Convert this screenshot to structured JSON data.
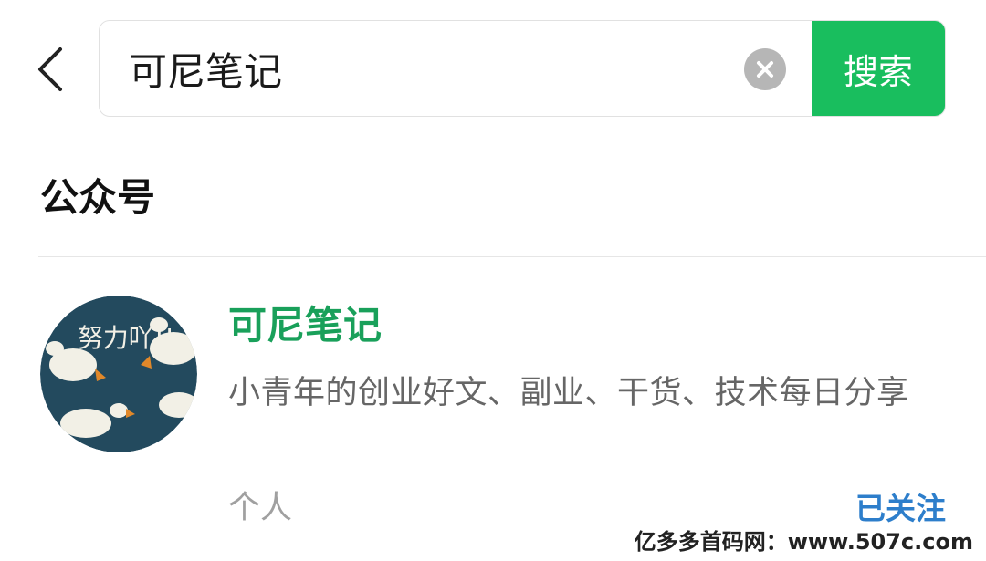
{
  "search": {
    "value": "可尼笔记",
    "button_label": "搜索"
  },
  "section": {
    "title": "公众号"
  },
  "result": {
    "name": "可尼笔记",
    "description": "小青年的创业好文、副业、干货、技术每日分享",
    "type": "个人",
    "follow_status": "已关注",
    "avatar": {
      "text": "努力吖!!",
      "background": "#234a5e"
    }
  },
  "watermark": "亿多多首码网：www.507c.com",
  "colors": {
    "accent_green": "#19be5e",
    "name_green": "#19a05a",
    "follow_blue": "#2d7ecb"
  }
}
